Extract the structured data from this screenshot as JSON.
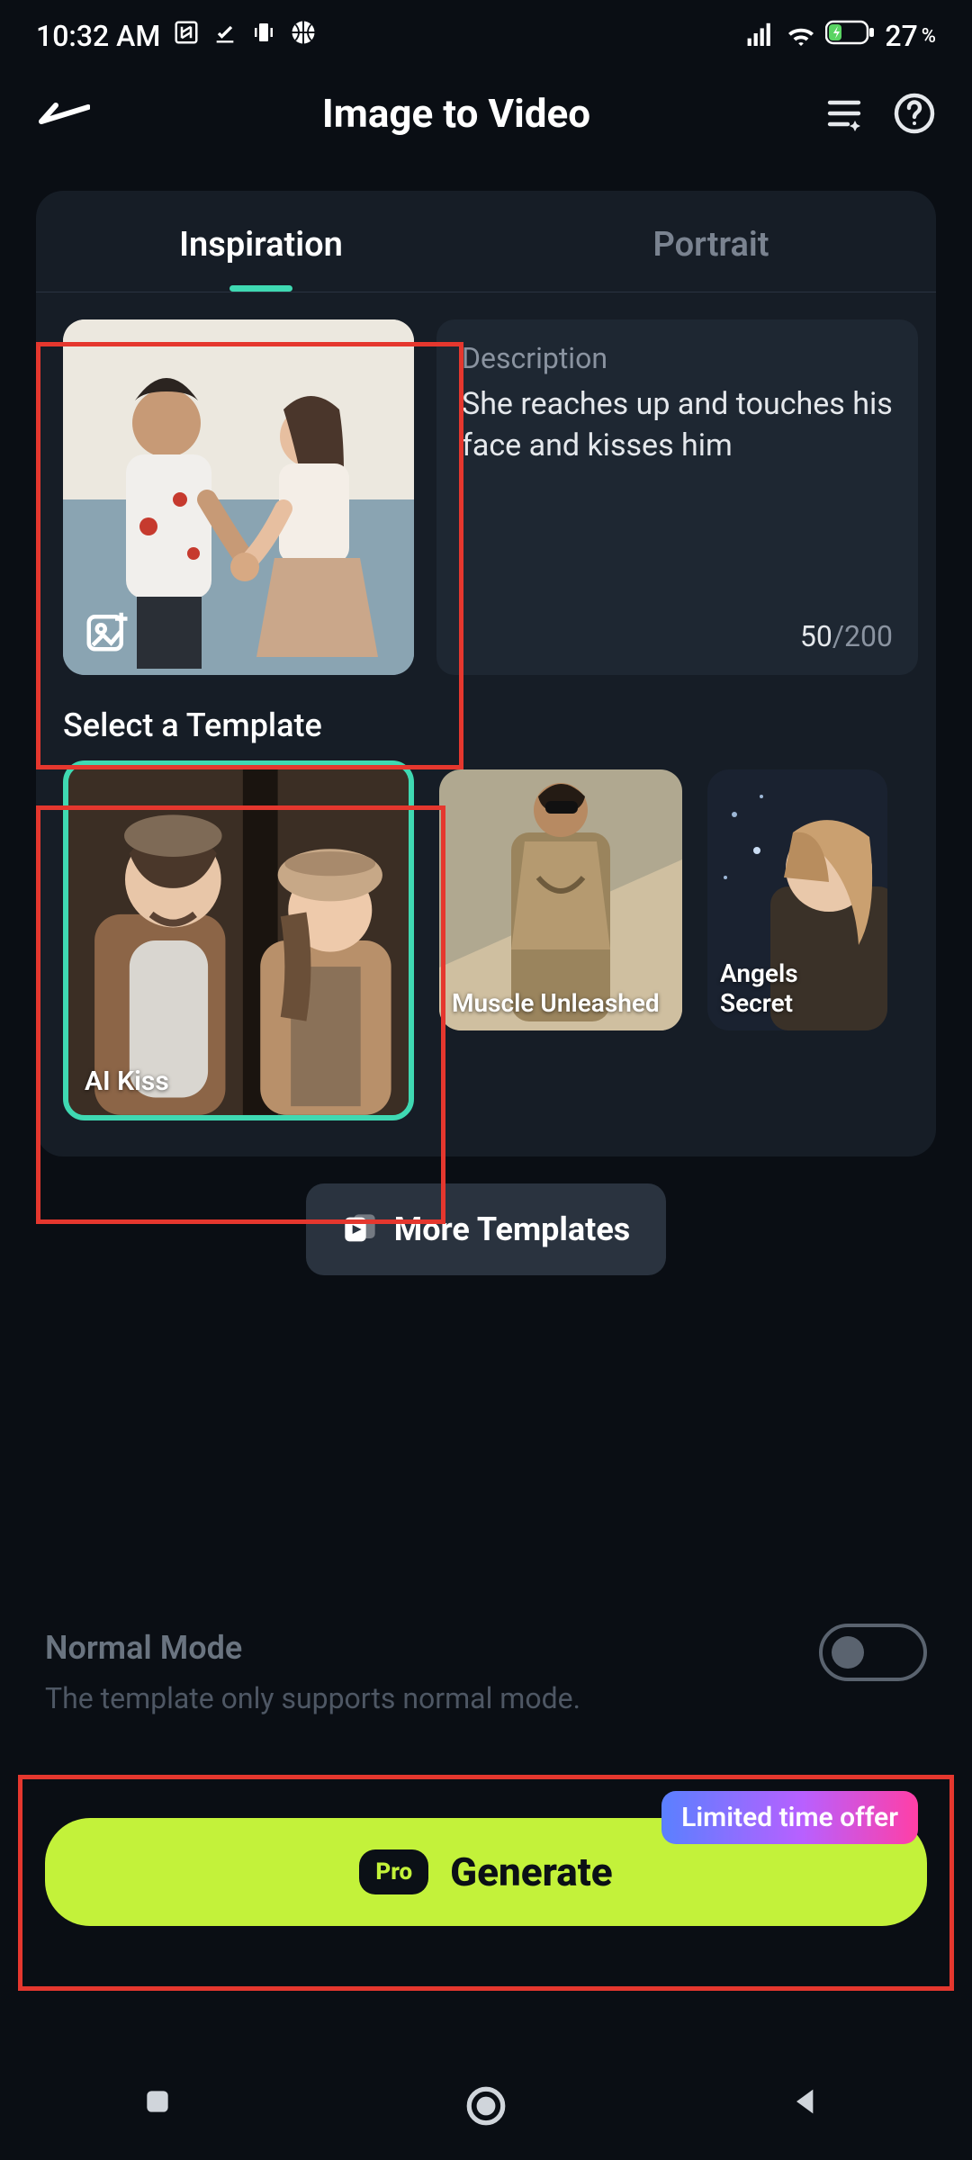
{
  "status": {
    "time": "10:32 AM",
    "battery_pct": "27",
    "percent_sign": "%"
  },
  "header": {
    "title": "Image to Video"
  },
  "tabs": {
    "inspiration": "Inspiration",
    "portrait": "Portrait"
  },
  "description_box": {
    "label": "Description",
    "text": "She reaches up and touches his face and kisses him",
    "current": "50",
    "sep": "/",
    "max": "200"
  },
  "select_template_title": "Select a Template",
  "templates": [
    {
      "label": "AI Kiss"
    },
    {
      "label": "Muscle Unleashed"
    },
    {
      "label": "Angels Secret"
    }
  ],
  "more_templates": "More Templates",
  "mode": {
    "title": "Normal Mode",
    "subtitle": "The template only supports normal mode."
  },
  "generate": {
    "lto": "Limited time offer",
    "pro": "Pro",
    "label": "Generate"
  }
}
